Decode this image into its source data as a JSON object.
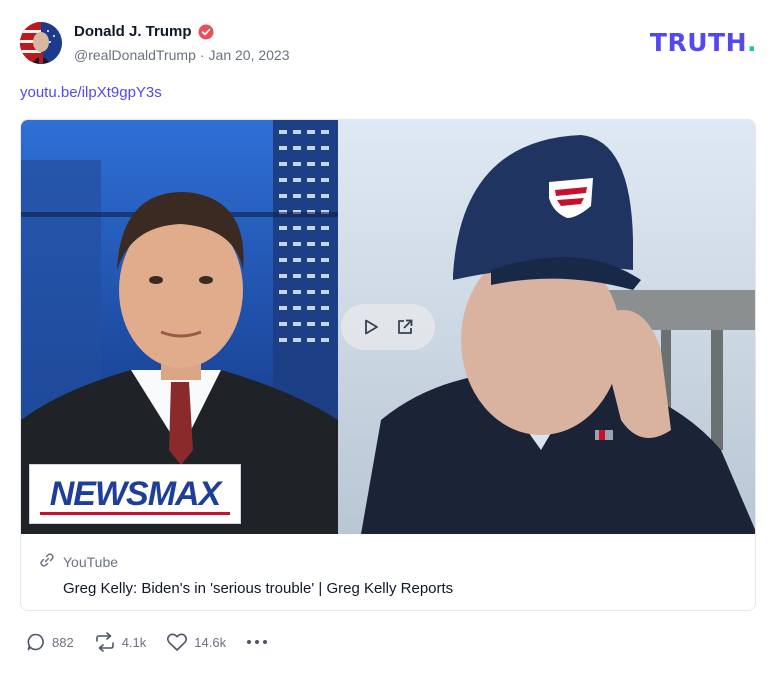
{
  "post": {
    "author_name": "Donald J. Trump",
    "handle": "@realDonaldTrump",
    "separator": "·",
    "date": "Jan 20, 2023",
    "link_text": "youtu.be/ilpXt9gpY3s"
  },
  "brand": {
    "wordmark": "TRUTH",
    "dot": ".",
    "color": "#5448ee",
    "dot_color": "#17c5b3"
  },
  "embed": {
    "source": "YouTube",
    "title": "Greg Kelly: Biden's in 'serious trouble' | Greg Kelly Reports",
    "thumbnail_logo_text": "NEWSMAX",
    "icons": [
      "link-icon",
      "play-icon",
      "external-link-icon"
    ]
  },
  "actions": {
    "replies": "882",
    "retruths": "4.1k",
    "likes": "14.6k"
  },
  "colors": {
    "accent": "#5448ee",
    "verified": "#e8505b",
    "muted_text": "#6b7280"
  }
}
